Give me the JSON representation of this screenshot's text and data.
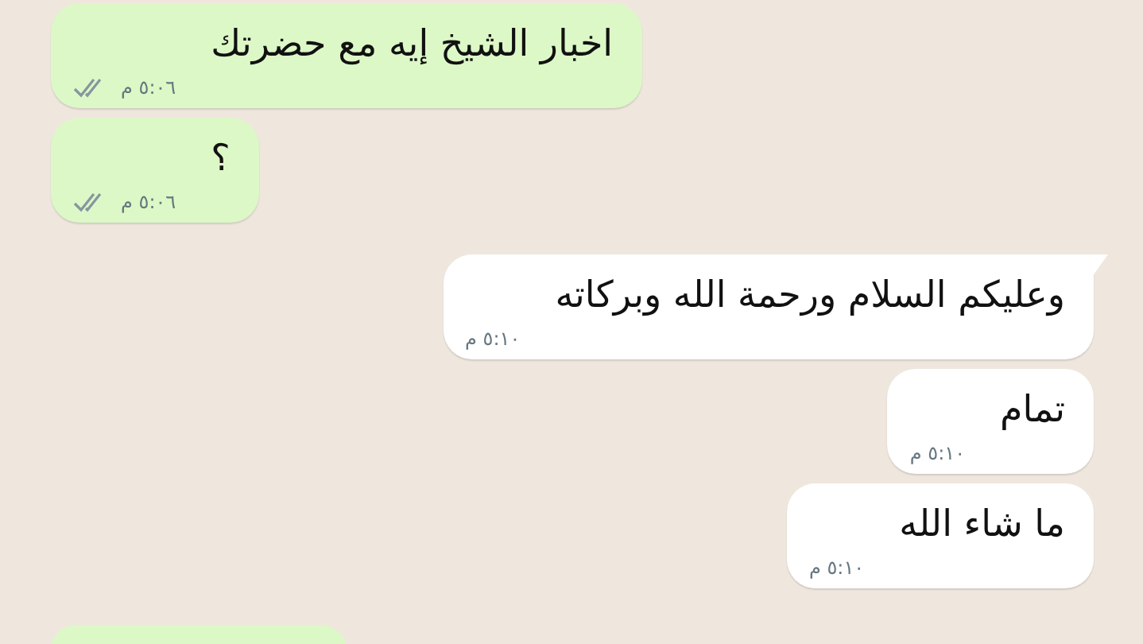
{
  "messages": [
    {
      "kind": "sent",
      "text": "اخبار الشيخ إيه مع حضرتك",
      "time": "٥:٠٦ م",
      "read": false,
      "tail": false
    },
    {
      "kind": "sent",
      "text": "؟",
      "time": "٥:٠٦ م",
      "read": false,
      "tail": false
    },
    {
      "kind": "received",
      "text": "وعليكم السلام ورحمة الله وبركاته",
      "time": "٥:١٠ م",
      "tail": true
    },
    {
      "kind": "received",
      "text": "تمام",
      "time": "٥:١٠ م",
      "tail": false
    },
    {
      "kind": "received",
      "text": "ما شاء الله",
      "time": "٥:١٠ م",
      "tail": false
    }
  ]
}
